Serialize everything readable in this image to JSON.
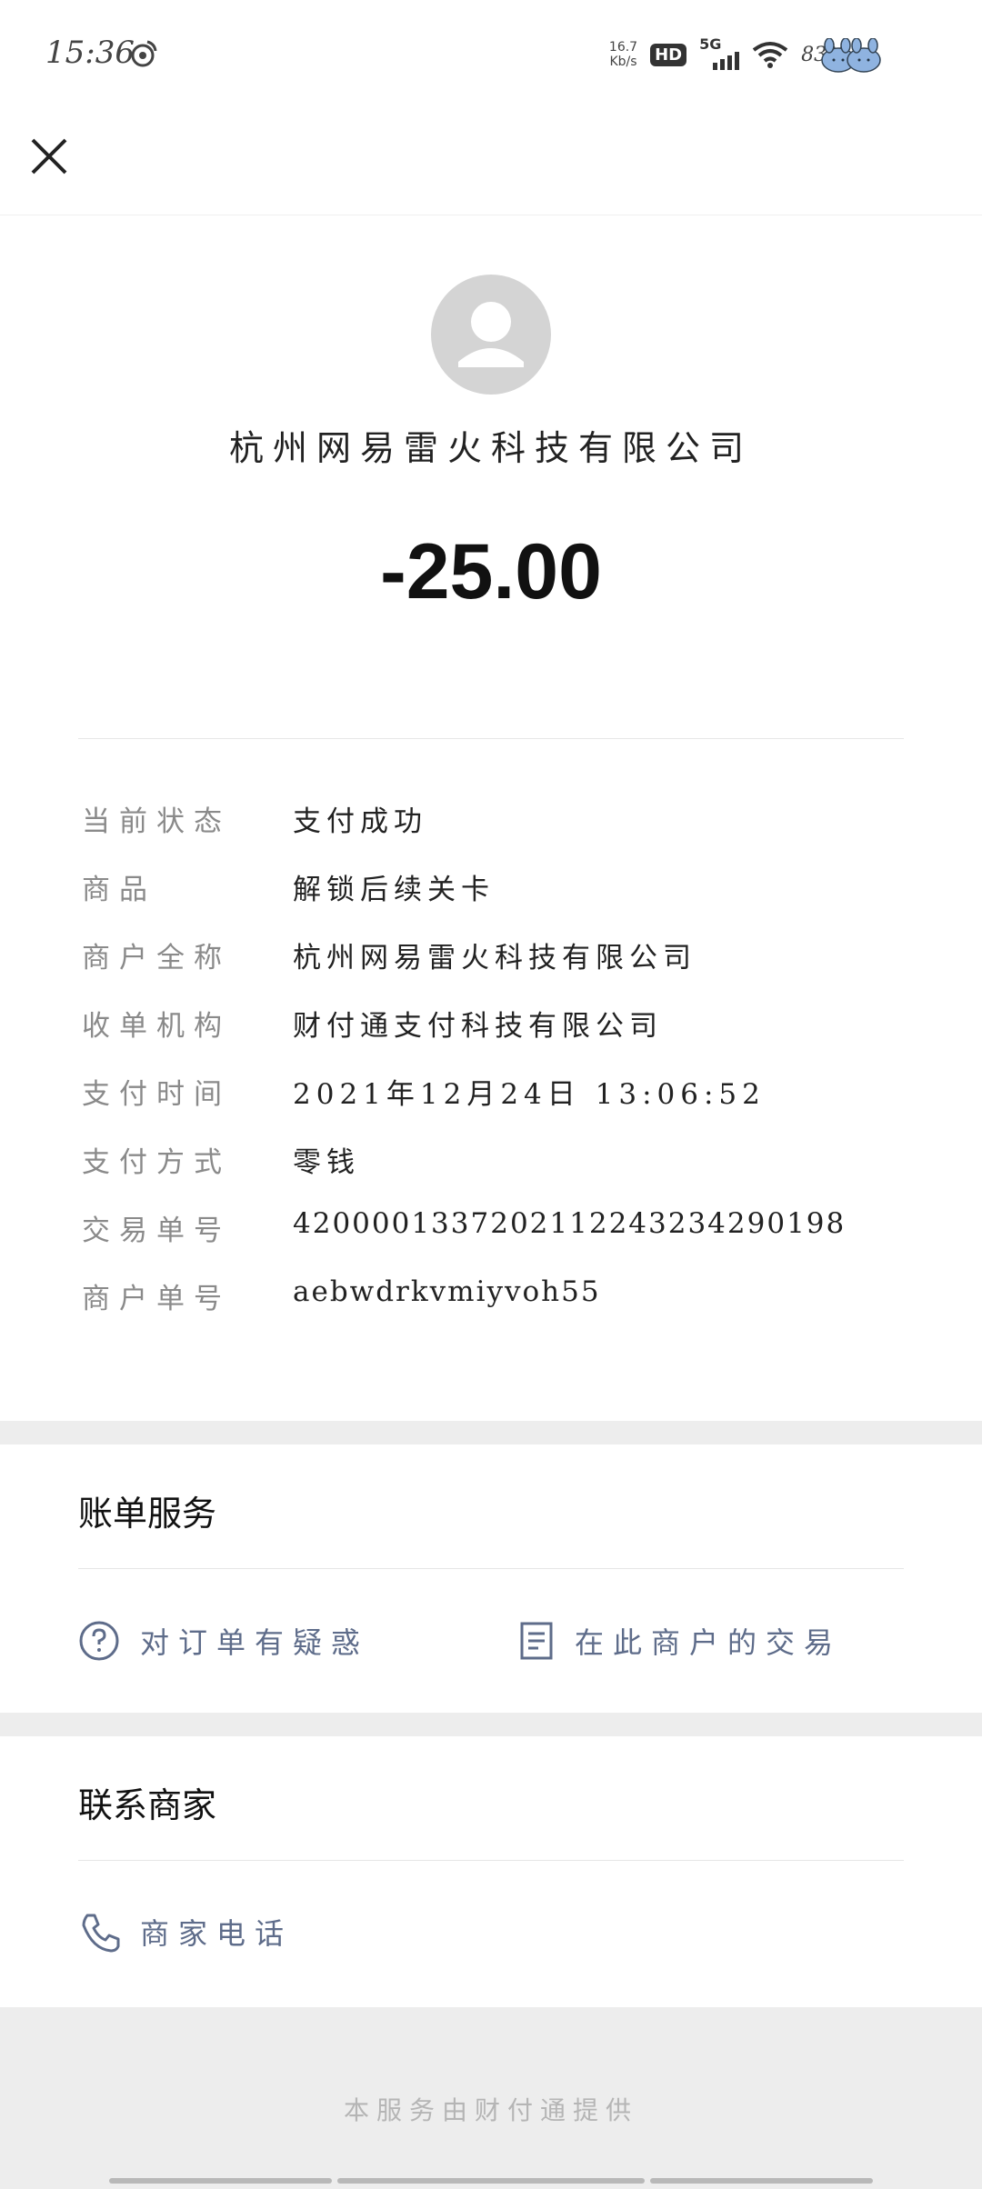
{
  "status_bar": {
    "time": "15:36",
    "net_speed_value": "16.7",
    "net_speed_unit": "Kb/s",
    "hd": "HD",
    "network": "5G",
    "battery": "83%"
  },
  "summary": {
    "merchant_name": "杭州网易雷火科技有限公司",
    "amount": "-25.00"
  },
  "details": [
    {
      "label": "当前状态",
      "value": "支付成功"
    },
    {
      "label": "商品",
      "value": "解锁后续关卡"
    },
    {
      "label": "商户全称",
      "value": "杭州网易雷火科技有限公司"
    },
    {
      "label": "收单机构",
      "value": "财付通支付科技有限公司"
    },
    {
      "label": "支付时间",
      "value": "2021年12月24日 13:06:52"
    },
    {
      "label": "支付方式",
      "value": "零钱"
    },
    {
      "label": "交易单号",
      "value": "4200001337202112243234290198"
    },
    {
      "label": "商户单号",
      "value": "aebwdrkvmiyvoh55"
    }
  ],
  "bill_service": {
    "title": "账单服务",
    "question_label": "对订单有疑惑",
    "history_label": "在此商户的交易"
  },
  "contact": {
    "title": "联系商家",
    "phone_label": "商家电话"
  },
  "footer": {
    "text": "本服务由财付通提供"
  },
  "colors": {
    "accent_link": "#5e6c8a",
    "label_gray": "#8a8a8a",
    "band_gray": "#ededed"
  }
}
